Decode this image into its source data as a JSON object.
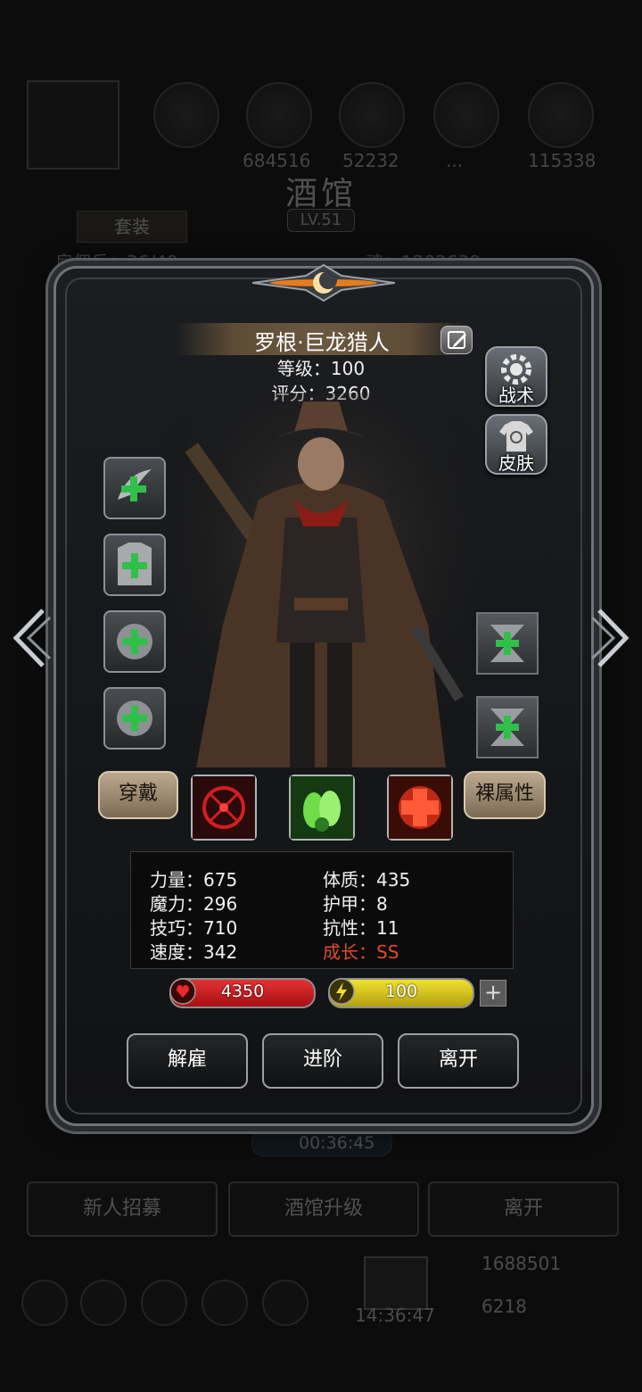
{
  "background": {
    "resources": [
      "684516",
      "52232",
      "...",
      "115338"
    ],
    "title": "酒馆",
    "level": "LV.51",
    "set_label": "套装",
    "slots_text": "雇佣兵：36/40",
    "soul_text": "魂：1202639",
    "timer": "00:36:45",
    "buttons": [
      "新人招募",
      "酒馆升级",
      "离开"
    ],
    "clock": "14:36:47",
    "gold": "1688501",
    "gems": "6218"
  },
  "hero": {
    "name": "罗根·巨龙猎人",
    "level_label": "等级：100",
    "score_label": "评分：3260"
  },
  "side": {
    "tactics": "战术",
    "skin": "皮肤"
  },
  "tags": {
    "wear": "穿戴",
    "naked": "裸属性"
  },
  "stats": {
    "strength": "力量：675",
    "magic": "魔力：296",
    "skill": "技巧：710",
    "speed": "速度：342",
    "constitution": "体质：435",
    "armor": "护甲：8",
    "resist": "抗性：11",
    "growth": "成长：SS"
  },
  "bars": {
    "hp": "4350",
    "energy": "100",
    "plus": "+"
  },
  "actions": {
    "dismiss": "解雇",
    "advance": "进阶",
    "leave": "离开"
  },
  "colors": {
    "hp_red": "#c8161b",
    "energy_yellow": "#d3c21a",
    "growth_red": "#e14a2a"
  }
}
